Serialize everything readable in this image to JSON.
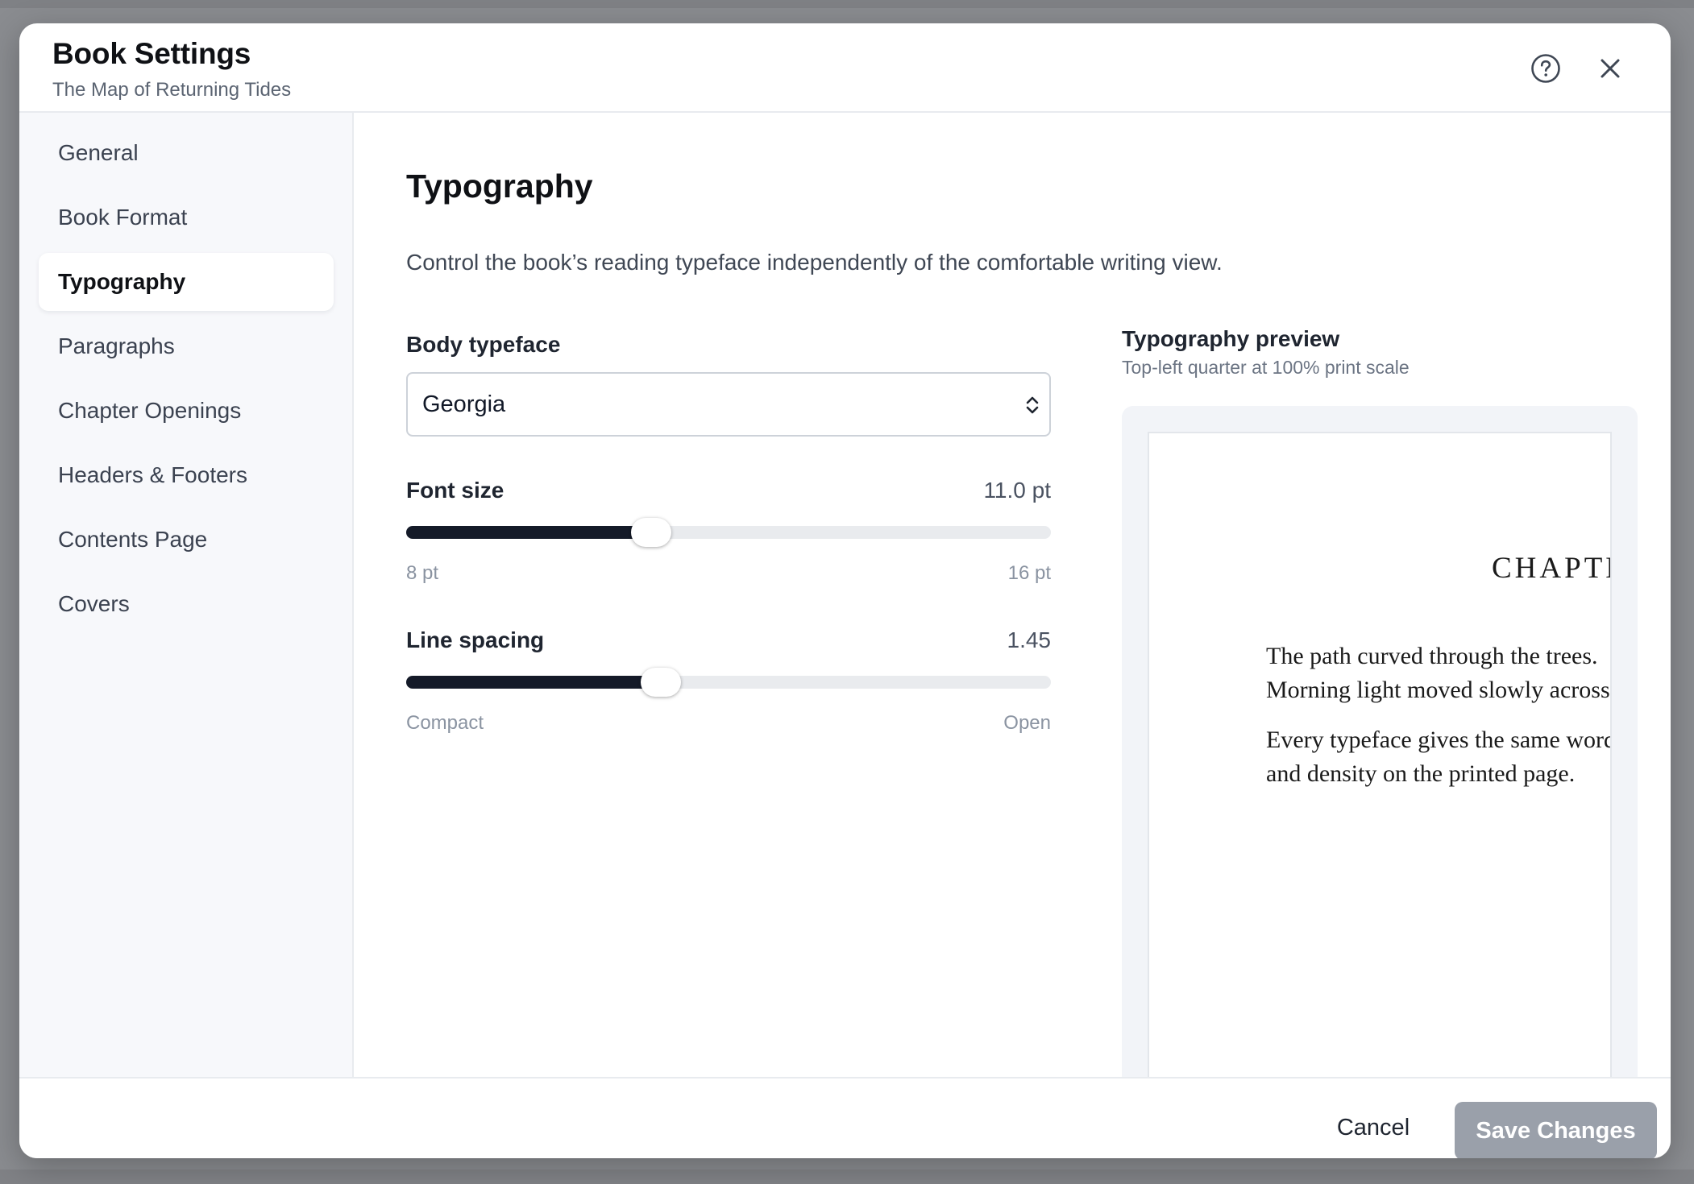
{
  "header": {
    "title": "Book Settings",
    "subtitle": "The Map of Returning Tides",
    "help_icon": "help-circle-icon",
    "close_icon": "close-icon"
  },
  "sidebar": {
    "items": [
      {
        "label": "General",
        "active": false
      },
      {
        "label": "Book Format",
        "active": false
      },
      {
        "label": "Typography",
        "active": true
      },
      {
        "label": "Paragraphs",
        "active": false
      },
      {
        "label": "Chapter Openings",
        "active": false
      },
      {
        "label": "Headers & Footers",
        "active": false
      },
      {
        "label": "Contents Page",
        "active": false
      },
      {
        "label": "Covers",
        "active": false
      }
    ]
  },
  "main": {
    "title": "Typography",
    "description": "Control the book’s reading typeface independently of the comfortable writing view.",
    "body_typeface": {
      "label": "Body typeface",
      "value": "Georgia"
    },
    "font_size": {
      "label": "Font size",
      "value": "11.0 pt",
      "min_label": "8 pt",
      "max_label": "16 pt",
      "fraction": 0.38
    },
    "line_spacing": {
      "label": "Line spacing",
      "value": "1.45",
      "min_label": "Compact",
      "max_label": "Open",
      "fraction": 0.395
    }
  },
  "preview": {
    "title": "Typography preview",
    "subtitle": "Top-left quarter at 100% print scale",
    "chapter": "CHAPTER",
    "paragraph1": [
      "The path curved through the trees.",
      "Morning light moved slowly across"
    ],
    "paragraph2": [
      "Every typeface gives the same words",
      "and density on the printed page."
    ]
  },
  "footer": {
    "cancel_label": "Cancel",
    "save_label": "Save Changes"
  },
  "colors": {
    "accent": "#141a28",
    "save_disabled": "#9aa0aa",
    "active_nav_bg": "#ffffff",
    "sidebar_bg": "#f7f8fb"
  }
}
